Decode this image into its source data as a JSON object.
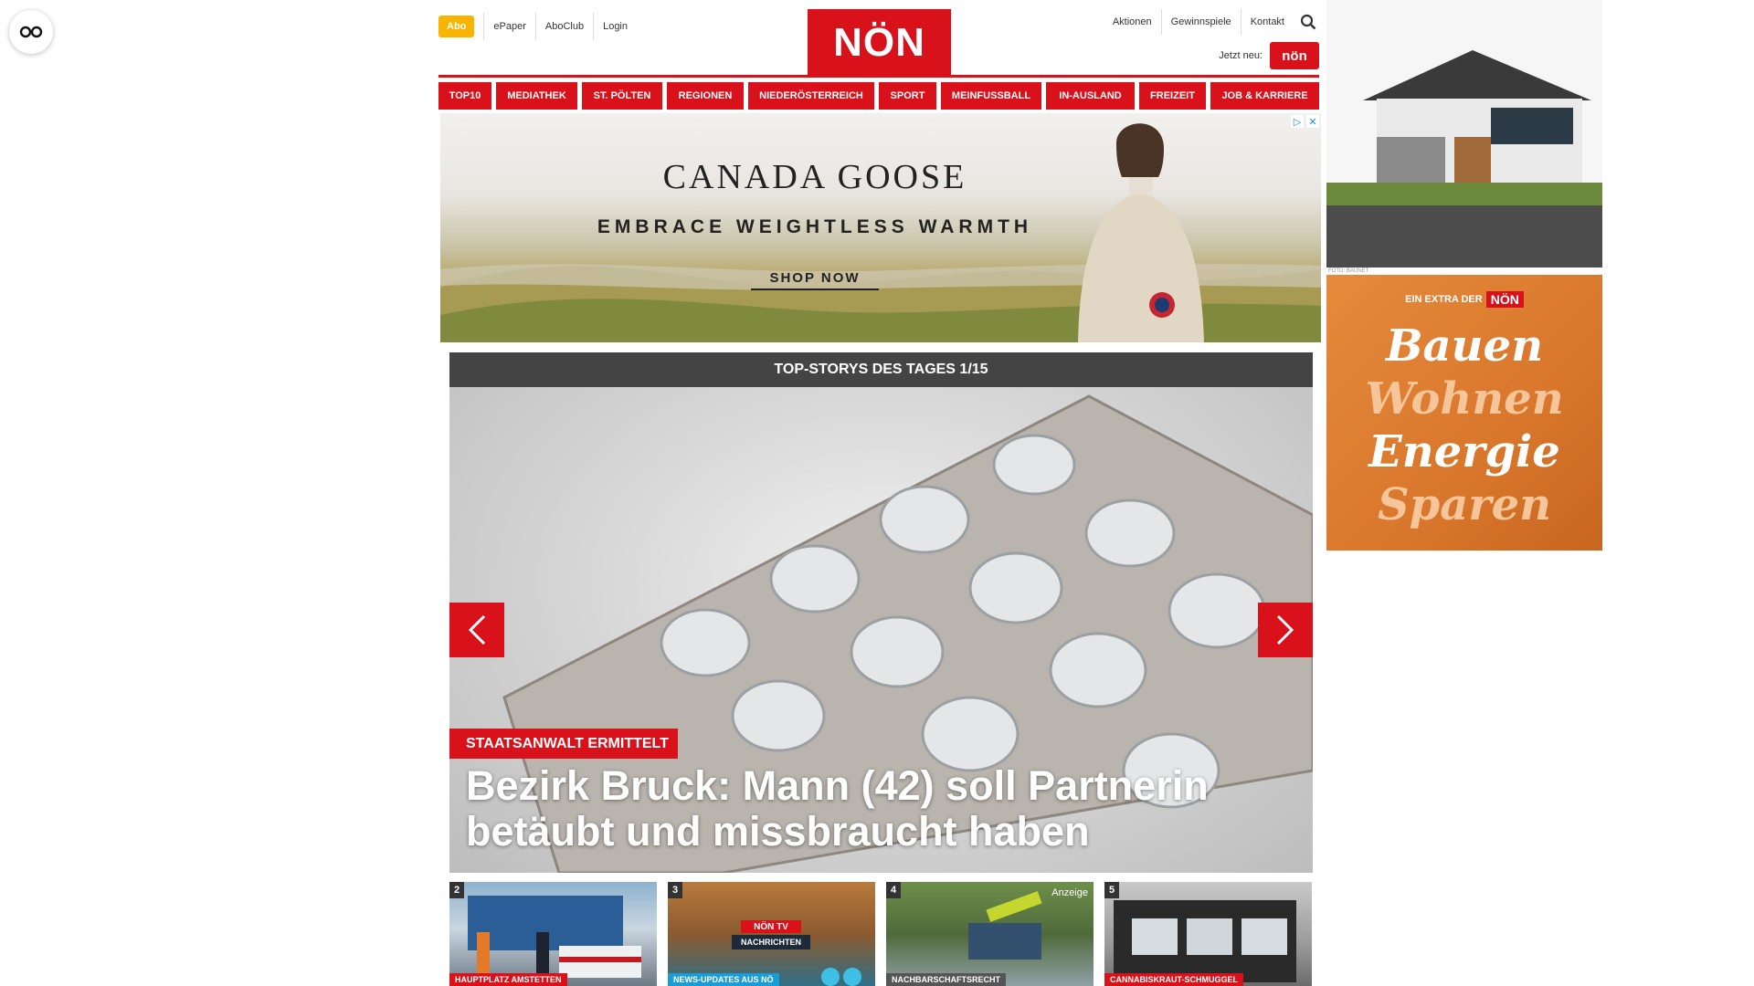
{
  "header": {
    "abo_label": "Abo",
    "left_links": [
      "ePaper",
      "AboClub",
      "Login"
    ],
    "logo_text": "NÖN",
    "right_links": [
      "Aktionen",
      "Gewinnspiele",
      "Kontakt"
    ],
    "jetzt_neu_label": "Jetzt neu:",
    "mini_logo_text": "nön"
  },
  "main_nav": [
    "TOP10",
    "MEDIATHEK",
    "ST. PÖLTEN",
    "REGIONEN",
    "NIEDERÖSTERREICH",
    "SPORT",
    "MEINFUSSBALL",
    "IN-AUSLAND",
    "FREIZEIT",
    "JOB & KARRIERE"
  ],
  "banner_ad": {
    "brand": "CANADA GOOSE",
    "tagline": "EMBRACE WEIGHTLESS WARMTH",
    "cta": "SHOP NOW"
  },
  "sidebar_ad": {
    "credit": "FOTO: BAUNET",
    "extra_label": "EIN EXTRA DER",
    "extra_logo": "NÖN",
    "words": [
      "Bauen",
      "Wohnen",
      "Energie",
      "Sparen"
    ]
  },
  "top_stories": {
    "heading": "TOP-STORYS DES TAGES 1/15",
    "hero": {
      "tag": "STAATSANWALT ERMITTELT",
      "headline": "Bezirk Bruck: Mann (42) soll Partnerin betäubt und missbraucht haben"
    },
    "thumbs": [
      {
        "num": "2",
        "category": "HAUPTPLATZ AMSTETTEN"
      },
      {
        "num": "3",
        "category": "NEWS-UPDATES AUS NÖ",
        "badge": "NÖN TV",
        "subtitle": "NACHRICHTEN"
      },
      {
        "num": "4",
        "category": "NACHBARSCHAFTSRECHT",
        "ad_label": "Anzeige"
      },
      {
        "num": "5",
        "category": "CANNABISKRAUT-SCHMUGGEL"
      }
    ]
  },
  "colors": {
    "brand_red": "#d8111b",
    "abo_yellow": "#f8b400",
    "story_header": "#444444"
  }
}
